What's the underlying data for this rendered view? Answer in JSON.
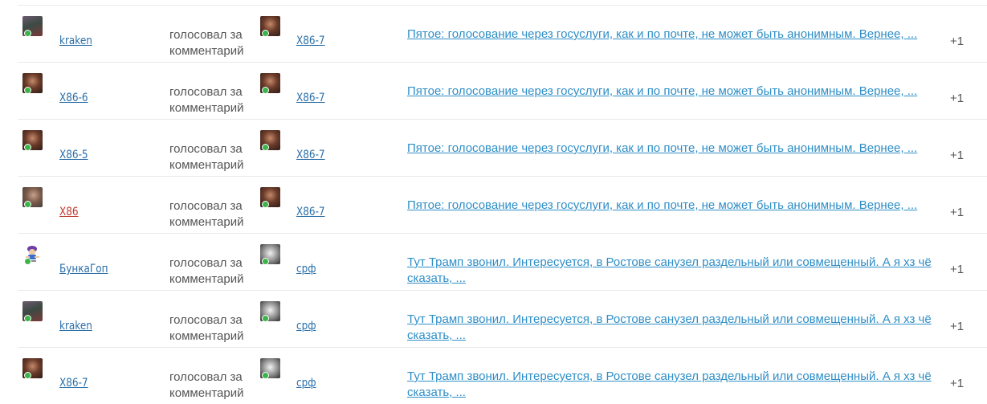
{
  "colors": {
    "link": "#2b6fa8",
    "comment_link": "#2e8ec7",
    "special_user": "#c0392b",
    "online_dot": "#3bb54a",
    "text": "#555555"
  },
  "rows": [
    {
      "voter": "kraken",
      "voter_avatar": "kraken",
      "action": "голосовал за комментарий",
      "target": "X86-7",
      "target_avatar": "x86",
      "comment": "Пятое: голосование через госуслуги, как и по почте, не может быть анонимным. Вернее, ...",
      "score": "+1"
    },
    {
      "voter": "X86-6",
      "voter_avatar": "x86",
      "action": "голосовал за комментарий",
      "target": "X86-7",
      "target_avatar": "x86",
      "comment": "Пятое: голосование через госуслуги, как и по почте, не может быть анонимным. Вернее, ...",
      "score": "+1"
    },
    {
      "voter": "X86-5",
      "voter_avatar": "x86",
      "action": "голосовал за комментарий",
      "target": "X86-7",
      "target_avatar": "x86",
      "comment": "Пятое: голосование через госуслуги, как и по почте, не может быть анонимным. Вернее, ...",
      "score": "+1"
    },
    {
      "voter": "X86",
      "voter_avatar": "x86b",
      "action": "голосовал за комментарий",
      "target": "X86-7",
      "target_avatar": "x86",
      "comment": "Пятое: голосование через госуслуги, как и по почте, не может быть анонимным. Вернее, ...",
      "score": "+1"
    },
    {
      "voter": "БункаГоп",
      "voter_avatar": "bunka",
      "action": "голосовал за комментарий",
      "target": "срф",
      "target_avatar": "srf",
      "comment": "Тут Трамп звонил. Интересуется, в Ростове санузел раздельный или совмещенный. А я хз чё сказать, ...",
      "score": "+1"
    },
    {
      "voter": "kraken",
      "voter_avatar": "kraken",
      "action": "голосовал за комментарий",
      "target": "срф",
      "target_avatar": "srf",
      "comment": "Тут Трамп звонил. Интересуется, в Ростове санузел раздельный или совмещенный. А я хз чё сказать, ...",
      "score": "+1"
    },
    {
      "voter": "X86-7",
      "voter_avatar": "x86",
      "action": "голосовал за комментарий",
      "target": "срф",
      "target_avatar": "srf",
      "comment": "Тут Трамп звонил. Интересуется, в Ростове санузел раздельный или совмещенный. А я хз чё сказать, ...",
      "score": "+1"
    }
  ]
}
